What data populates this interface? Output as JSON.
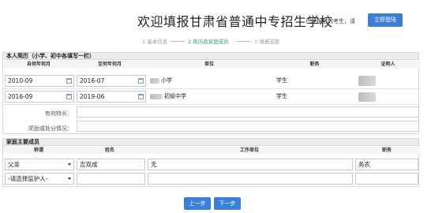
{
  "header": {
    "title": "欢迎填报甘肃省普通中专招生学校",
    "login_hint": "已经报名的考生，请",
    "login_button": "立即登陆"
  },
  "steps": [
    {
      "label": "1 基本信息",
      "active": false
    },
    {
      "label": "2 简历及家庭成员",
      "active": true
    },
    {
      "label": "3 填报志愿",
      "active": false
    }
  ],
  "resume": {
    "section_title": "本人简历（小学、初中各填写一栏）",
    "columns": [
      "自何年何月",
      "至何年何月",
      "单位",
      "职务",
      "证明人"
    ],
    "rows": [
      {
        "from": "2010-09",
        "to": "2016-07",
        "unit": "小学",
        "position": "学生",
        "witness": ""
      },
      {
        "from": "2016-09",
        "to": "2019-06",
        "unit": "初级中学",
        "position": "学生",
        "witness": ""
      }
    ],
    "specialty_label": "有何特长：",
    "specialty_value": "",
    "rewards_label": "奖励或处分情况：",
    "rewards_value": ""
  },
  "family": {
    "section_title": "家庭主要成员",
    "columns": [
      "称谓",
      "姓名",
      "工作单位",
      "职务"
    ],
    "rows": [
      {
        "relation": "父亲",
        "name": "吉双成",
        "workplace": "无",
        "position": "务农"
      },
      {
        "relation": "-请选择监护人-",
        "name": "",
        "workplace": "",
        "position": ""
      }
    ]
  },
  "buttons": {
    "prev": "上一步",
    "next": "下一步"
  },
  "colors": {
    "primary": "#3b7fd6",
    "step_active": "#3aa06b"
  }
}
